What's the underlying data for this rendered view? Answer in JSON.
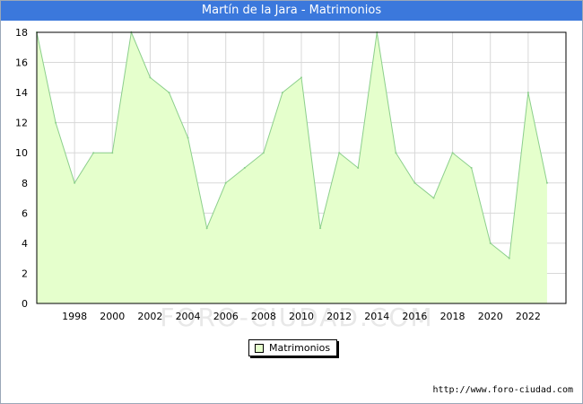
{
  "title": "Martín de la Jara - Matrimonios",
  "watermark": "FORO-CIUDAD.COM",
  "source_url": "http://www.foro-ciudad.com",
  "colors": {
    "header": "#3b78dc",
    "fill": "#e5ffcc",
    "line": "#8ccf8c",
    "grid": "#d8d8d8"
  },
  "chart_data": {
    "type": "area",
    "title": "Martín de la Jara - Matrimonios",
    "xlabel": "",
    "ylabel": "",
    "xlim": [
      1996,
      2024
    ],
    "ylim": [
      0,
      18
    ],
    "yticks": [
      0,
      2,
      4,
      6,
      8,
      10,
      12,
      14,
      16,
      18
    ],
    "xticks": [
      1998,
      2000,
      2002,
      2004,
      2006,
      2008,
      2010,
      2012,
      2014,
      2016,
      2018,
      2020,
      2022
    ],
    "grid": true,
    "legend_position": "bottom-center",
    "x": [
      1996,
      1997,
      1998,
      1999,
      2000,
      2001,
      2002,
      2003,
      2004,
      2005,
      2006,
      2007,
      2008,
      2009,
      2010,
      2011,
      2012,
      2013,
      2014,
      2015,
      2016,
      2017,
      2018,
      2019,
      2020,
      2021,
      2022,
      2023
    ],
    "series": [
      {
        "name": "Matrimonios",
        "values": [
          18,
          12,
          8,
          10,
          10,
          18,
          15,
          14,
          11,
          5,
          8,
          9,
          10,
          14,
          15,
          5,
          10,
          9,
          18,
          10,
          8,
          7,
          10,
          9,
          4,
          3,
          14,
          8
        ]
      }
    ]
  }
}
